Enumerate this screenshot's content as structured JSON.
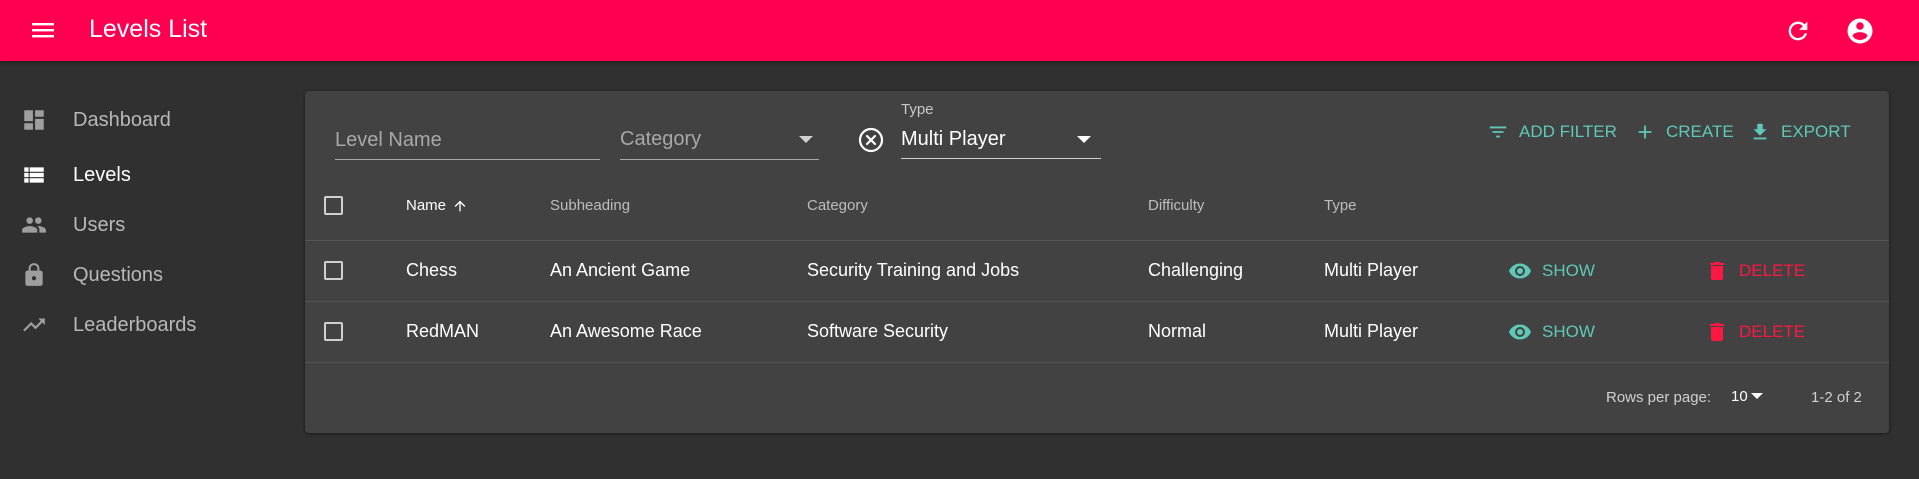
{
  "appbar": {
    "title": "Levels List",
    "accent": "#ff0050",
    "icons": [
      "menu-icon",
      "refresh-icon",
      "account-circle-icon"
    ]
  },
  "sidebar": {
    "items": [
      {
        "label": "Dashboard",
        "icon": "dashboard-icon",
        "active": false
      },
      {
        "label": "Levels",
        "icon": "list-icon",
        "active": true
      },
      {
        "label": "Users",
        "icon": "people-icon",
        "active": false
      },
      {
        "label": "Questions",
        "icon": "lock-icon",
        "active": false
      },
      {
        "label": "Leaderboards",
        "icon": "trending-up-icon",
        "active": false
      }
    ]
  },
  "filters": {
    "level_name_placeholder": "Level Name",
    "category_placeholder": "Category",
    "type_label": "Type",
    "type_value": "Multi Player"
  },
  "toolbar": {
    "add_filter": "ADD FILTER",
    "create": "CREATE",
    "export": "EXPORT"
  },
  "table": {
    "headers": {
      "name": "Name",
      "subheading": "Subheading",
      "category": "Category",
      "difficulty": "Difficulty",
      "type": "Type"
    },
    "rows": [
      {
        "name": "Chess",
        "subheading": "An Ancient Game",
        "category": "Security Training and Jobs",
        "difficulty": "Challenging",
        "type": "Multi Player",
        "show": "SHOW",
        "delete": "DELETE"
      },
      {
        "name": "RedMAN",
        "subheading": "An Awesome Race",
        "category": "Software Security",
        "difficulty": "Normal",
        "type": "Multi Player",
        "show": "SHOW",
        "delete": "DELETE"
      }
    ]
  },
  "pagination": {
    "rows_per_page_label": "Rows per page:",
    "rows_per_page_value": "10",
    "range": "1-2 of 2"
  },
  "colors": {
    "background": "#303030",
    "card": "#424242",
    "teal": "#5ec9b6",
    "danger": "#ff1744"
  }
}
